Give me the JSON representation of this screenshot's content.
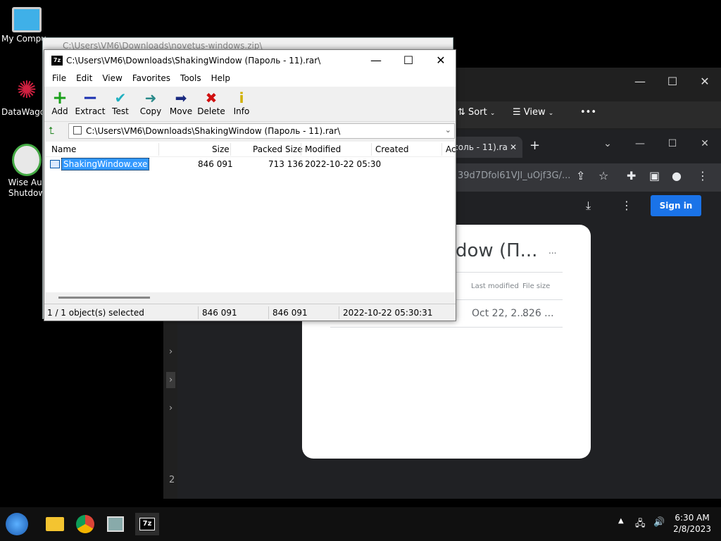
{
  "desktop": {
    "icons": [
      {
        "label": "My Compu"
      },
      {
        "label": "DataWago"
      },
      {
        "label": "Wise Aut"
      },
      {
        "label": "Shutdow"
      }
    ]
  },
  "explorer": {
    "sort_label": "Sort",
    "view_label": "View",
    "more": "•••",
    "sidebar_num": "2"
  },
  "chrome": {
    "tab_title": "Асоль - 11).ra",
    "url": "39d7Dfol61VJl_uOjf3G/...",
    "signin_label": "Sign in",
    "card_title": "dow (П...",
    "card_more": "...",
    "col_last_modified": "Last modified",
    "col_file_size": "File size",
    "file_modified": "Oct 22, 2...",
    "file_size": "826 ..."
  },
  "z7_background": {
    "title": "C:\\Users\\VM6\\Downloads\\novetus-windows.zip\\"
  },
  "z7": {
    "app_icon": "7z",
    "title": "C:\\Users\\VM6\\Downloads\\ShakingWindow (Пароль - 11).rar\\",
    "menu": [
      "File",
      "Edit",
      "View",
      "Favorites",
      "Tools",
      "Help"
    ],
    "toolbar": [
      {
        "label": "Add",
        "icon": "add-icon",
        "color": "#1aa01a"
      },
      {
        "label": "Extract",
        "icon": "extract-icon",
        "color": "#1a2fb0"
      },
      {
        "label": "Test",
        "icon": "test-icon",
        "color": "#20b0c0"
      },
      {
        "label": "Copy",
        "icon": "copy-icon",
        "color": "#2a8a8a"
      },
      {
        "label": "Move",
        "icon": "move-icon",
        "color": "#1a2a80"
      },
      {
        "label": "Delete",
        "icon": "delete-icon",
        "color": "#d01010"
      },
      {
        "label": "Info",
        "icon": "info-icon",
        "color": "#d0b000"
      }
    ],
    "address": "C:\\Users\\VM6\\Downloads\\ShakingWindow (Пароль - 11).rar\\",
    "columns": {
      "name": "Name",
      "size": "Size",
      "packed": "Packed Size",
      "modified": "Modified",
      "created": "Created",
      "accessed": "Ac"
    },
    "rows": [
      {
        "name": "ShakingWindow.exe",
        "size": "846 091",
        "packed": "713 136",
        "modified": "2022-10-22 05:30"
      }
    ],
    "status": {
      "selected": "1 / 1 object(s) selected",
      "size": "846 091",
      "packed": "846 091",
      "modified": "2022-10-22 05:30:31"
    }
  },
  "taskbar": {
    "time": "6:30 AM",
    "date": "2/8/2023",
    "active_app_label": "7z"
  }
}
